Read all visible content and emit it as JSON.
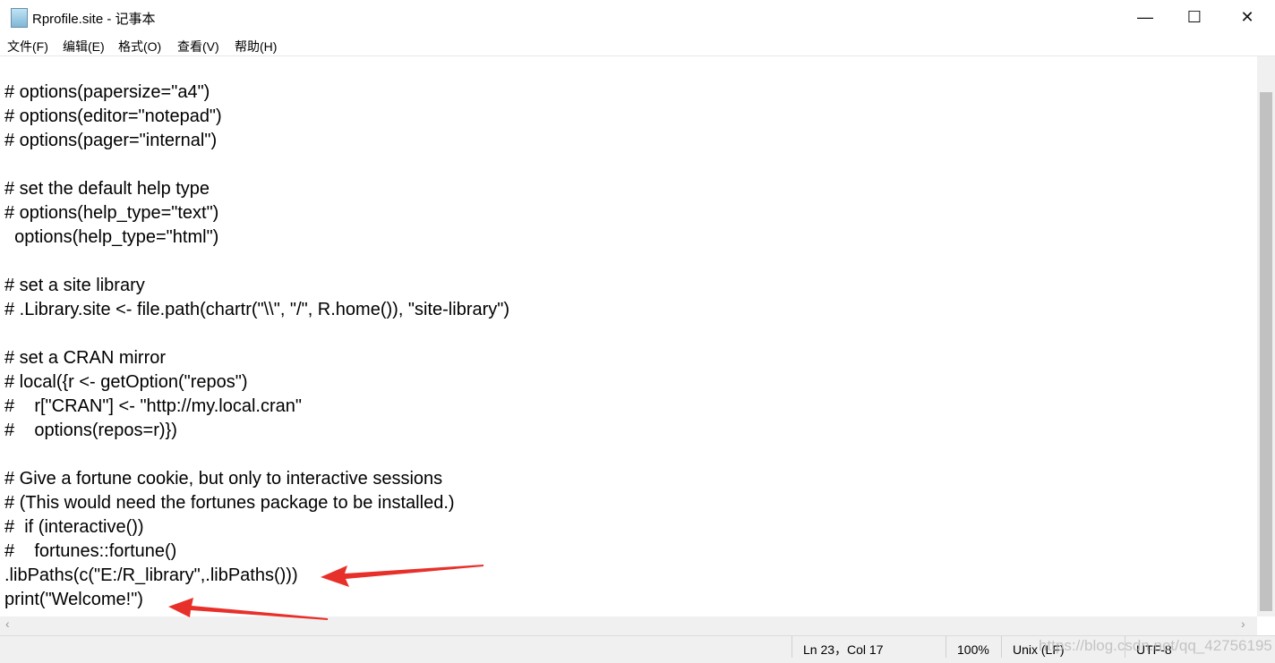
{
  "window": {
    "title": "Rprofile.site - 记事本",
    "minimize": "—",
    "maximize": "☐",
    "close": "✕"
  },
  "menu": [
    "文件(F)",
    "编辑(E)",
    "格式(O)",
    "查看(V)",
    "帮助(H)"
  ],
  "lines": [
    "",
    "# options(papersize=\"a4\")",
    "# options(editor=\"notepad\")",
    "# options(pager=\"internal\")",
    "",
    "# set the default help type",
    "# options(help_type=\"text\")",
    "  options(help_type=\"html\")",
    "",
    "# set a site library",
    "# .Library.site <- file.path(chartr(\"\\\\\", \"/\", R.home()), \"site-library\")",
    "",
    "# set a CRAN mirror",
    "# local({r <- getOption(\"repos\")",
    "#\tr[\"CRAN\"] <- \"http://my.local.cran\"",
    "#\toptions(repos=r)})",
    "",
    "# Give a fortune cookie, but only to interactive sessions",
    "# (This would need the fortunes package to be installed.)",
    "#  if (interactive())",
    "#    fortunes::fortune()",
    ".libPaths(c(\"E:/R_library\",.libPaths()))",
    "print(\"Welcome!\")"
  ],
  "status": {
    "position": "Ln 23，Col 17",
    "zoom": "100%",
    "eol": "Unix (LF)",
    "encoding": "UTF-8"
  },
  "watermark": "https://blog.csdn.net/qq_42756195",
  "annotation_color": "#e8302a"
}
